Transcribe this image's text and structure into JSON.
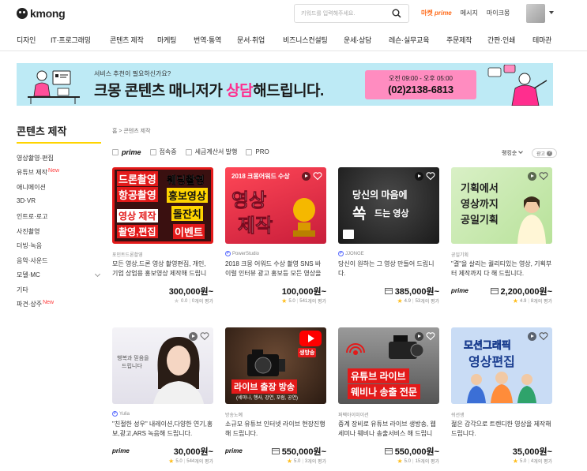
{
  "header": {
    "logo": "kmong",
    "search_placeholder": "키워드를 입력해주세요.",
    "market_prime": {
      "prefix": "마켓",
      "suffix": "prime"
    },
    "messages": "메시지",
    "mykmong": "마이크몽",
    "colors": {
      "accent": "#ff6b1a",
      "yellow": "#ffd400"
    }
  },
  "nav": {
    "categories": [
      "디자인",
      "IT·프로그래밍",
      "콘텐츠 제작",
      "마케팅",
      "번역·통역",
      "문서·취업",
      "비즈니스컨설팅",
      "운세·상담",
      "레슨·실무교육",
      "주문제작",
      "간판·인쇄",
      "테마관"
    ]
  },
  "banner": {
    "subtitle": "서비스 추천이 필요하신가요?",
    "title_pre": "크몽 콘텐츠 매니저가 ",
    "title_hl": "상담",
    "title_post": "해드립니다.",
    "hours": "오전 09:00 - 오후 05:00",
    "phone": "(02)2138-6813",
    "colors": {
      "bg": "#bdeaf5",
      "phone_bg": "#ff8cc0",
      "highlight": "#ff2e8e"
    }
  },
  "sidebar": {
    "title": "콘텐츠 제작",
    "new_label": "New",
    "items": [
      {
        "label": "영상촬영·편집",
        "new": false
      },
      {
        "label": "유튜브 제작",
        "new": true
      },
      {
        "label": "애니메이션",
        "new": false
      },
      {
        "label": "3D·VR",
        "new": false
      },
      {
        "label": "인트로·로고",
        "new": false
      },
      {
        "label": "사진촬영",
        "new": false
      },
      {
        "label": "더빙·녹음",
        "new": false
      },
      {
        "label": "음악·사운드",
        "new": false
      },
      {
        "label": "모델·MC",
        "new": false
      },
      {
        "label": "기타",
        "new": false
      },
      {
        "label": "파견·상주",
        "new": true
      }
    ]
  },
  "main": {
    "breadcrumb": "홈 > 콘텐츠 제작",
    "filters": {
      "prime": "prime",
      "online": "접속중",
      "tax_invoice": "세금계산서 발행",
      "pro": "PRO"
    },
    "sort_label": "랭킹순",
    "ad_label": "광고",
    "ad_help": "?",
    "prime_tag": "prime",
    "reviews_suffix": "개의 평가",
    "thumb_texts": {
      "c1": [
        "드론촬영",
        "웨딩촬영",
        "항공촬영",
        "홍보영상",
        "영상 제작",
        "돌잔치",
        "촬영,편집",
        "이벤트"
      ],
      "c2": [
        "2018 크몽어워드 수상",
        "영상",
        "제작"
      ],
      "c3": [
        "당신의 마음에",
        "쏙",
        "드는 영상"
      ],
      "c4": [
        "기획에서",
        "영상까지",
        "공일기획"
      ],
      "c5": [
        "행복과 믿음을",
        "드립니다"
      ],
      "c6": [
        "생방송",
        "라이브 출장 방송",
        "(세미나, 행사, 강연, 포럼, 공연)"
      ],
      "c7": [
        "유튜브 라이브",
        "웨비나 송출 전문"
      ],
      "c8": [
        "모션그래픽",
        "영상편집"
      ]
    },
    "cards": [
      {
        "seller": "포인트드론촬영",
        "seller_badge": false,
        "title": "모든 영상,드론 영상 촬영편집, 개인, 기업 상업용 홍보영상 제작해 드립니다.",
        "price": "300,000원~",
        "rating": "0.0",
        "reviews": "0",
        "prime": false,
        "price_icon": false,
        "star_on": false
      },
      {
        "seller": "PowerStudio",
        "seller_badge": true,
        "title": "2018 크몽 어워드 수상 촬영 SNS 바이럴 인터뷰 광고 홍보등 모든 영상을 제...",
        "price": "100,000원~",
        "rating": "5.0",
        "reviews": "541",
        "prime": false,
        "price_icon": false,
        "star_on": true
      },
      {
        "seller": "JJONGE",
        "seller_badge": true,
        "title": "당신이 원하는 그 영상 만들어 드립니다.",
        "price": "385,000원~",
        "rating": "4.9",
        "reviews": "53",
        "prime": false,
        "price_icon": true,
        "star_on": true
      },
      {
        "seller": "공일기획",
        "seller_badge": false,
        "title": "\"결\"을 살리는 퀄리티있는 영상, 기획부터 제작까지 다 해 드립니다.",
        "price": "2,200,000원~",
        "rating": "4.9",
        "reviews": "8",
        "prime": true,
        "price_icon": true,
        "star_on": true
      },
      {
        "seller": "Yulia",
        "seller_badge": true,
        "title": "\"친절한 성우\" 내레이션,다양한 연기,홍보,광고,ARS 녹음해 드립니다.",
        "price": "30,000원~",
        "rating": "5.0",
        "reviews": "544",
        "prime": true,
        "price_icon": false,
        "star_on": true
      },
      {
        "seller": "방송노예",
        "seller_badge": false,
        "title": "소규모 유튜브 인터넷 라이브 현장진행해 드립니다.",
        "price": "550,000원~",
        "rating": "5.0",
        "reviews": "3",
        "prime": true,
        "price_icon": true,
        "star_on": true
      },
      {
        "seller": "퍼펙아이미이션",
        "seller_badge": false,
        "title": "중계 장비로 유튜브 라이브 생방송, 웹세미나 웨비나 송출서비스 해 드립니다.",
        "price": "550,000원~",
        "rating": "5.0",
        "reviews": "15",
        "prime": false,
        "price_icon": true,
        "star_on": true
      },
      {
        "seller": "쉬선생",
        "seller_badge": false,
        "title": "젊은 감각으로 트렌디한 영상을 제작해 드립니다.",
        "price": "35,000원~",
        "rating": "5.0",
        "reviews": "4",
        "prime": false,
        "price_icon": false,
        "star_on": true
      }
    ]
  }
}
